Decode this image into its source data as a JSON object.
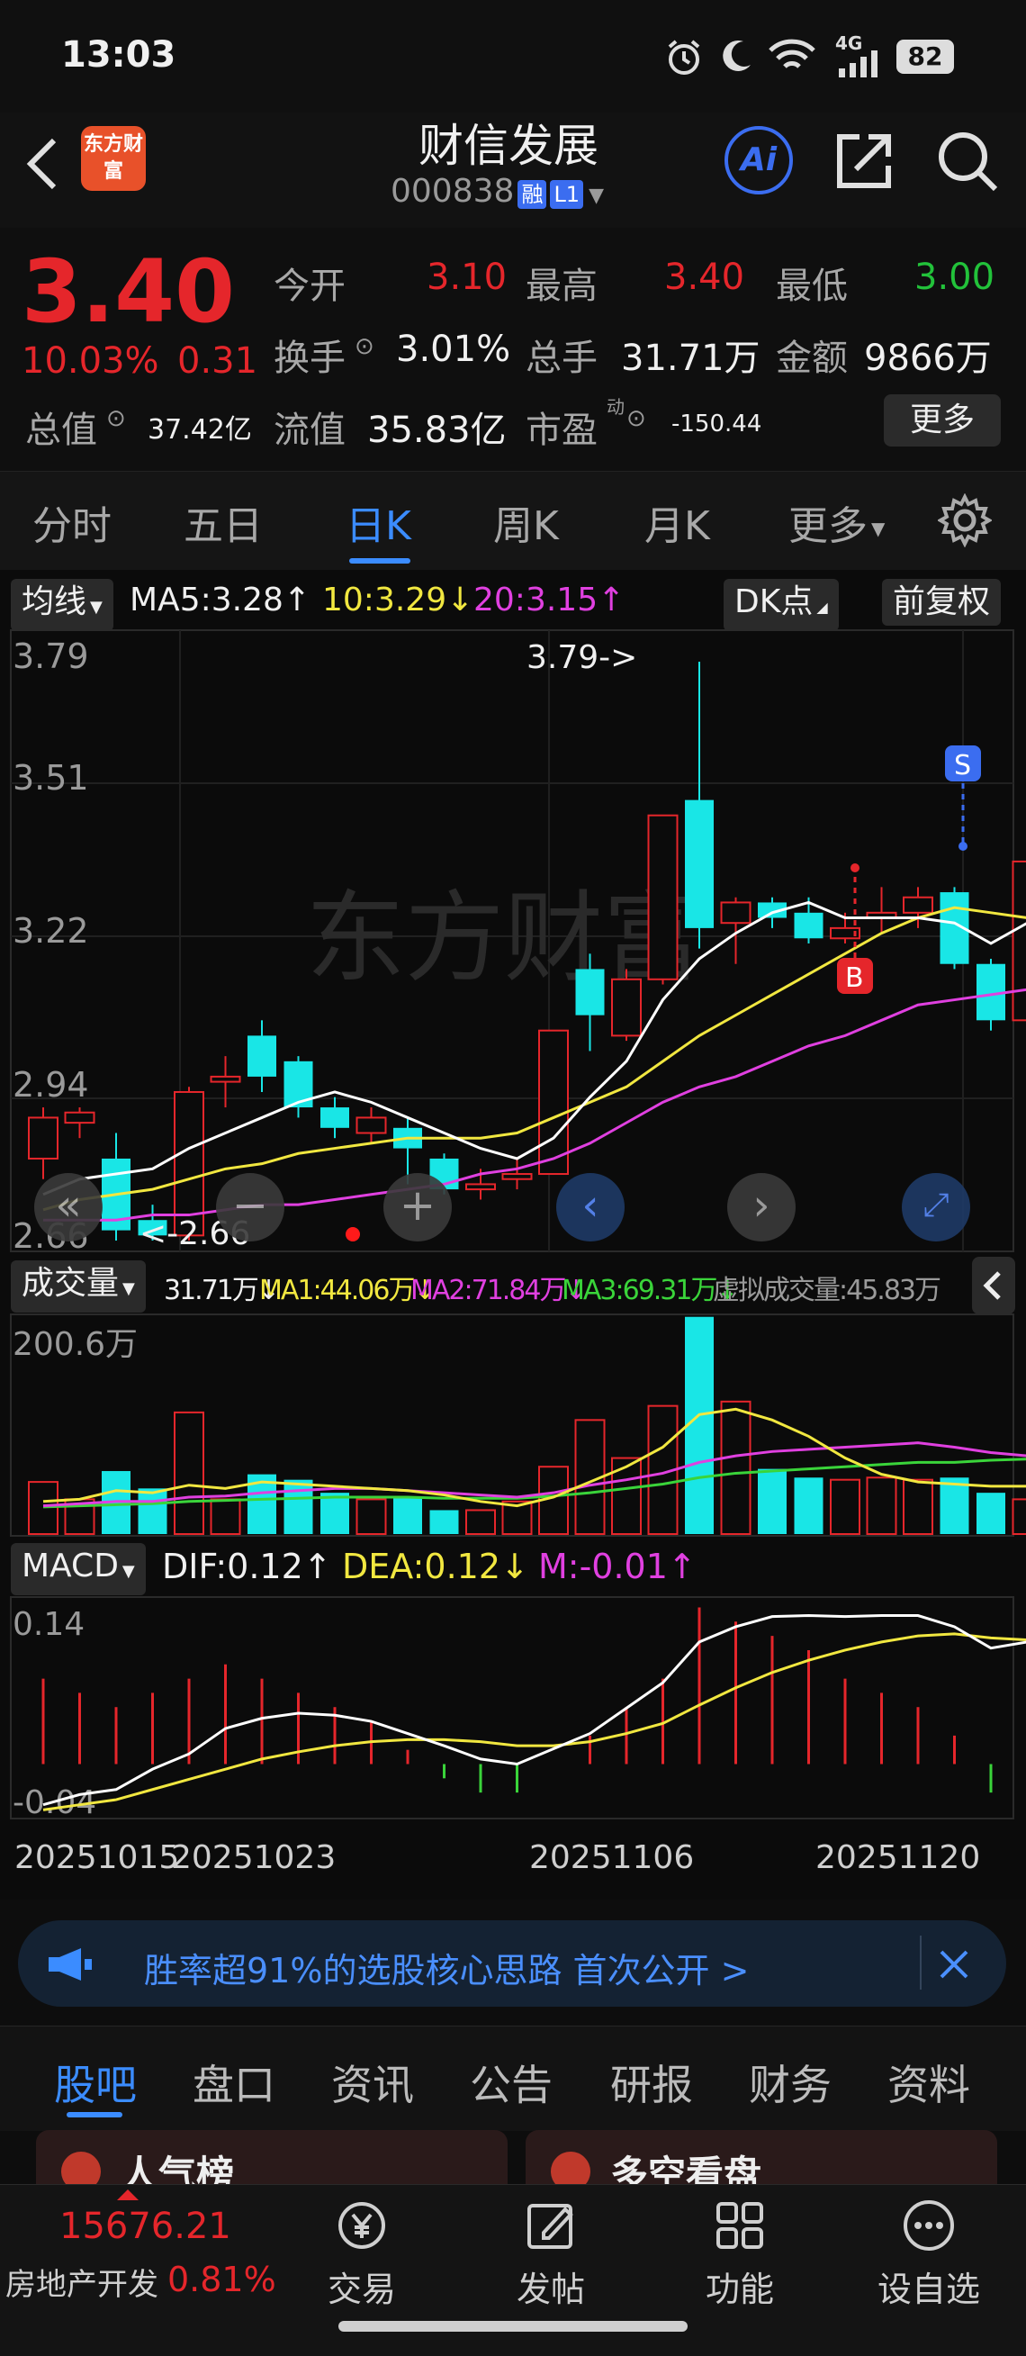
{
  "status_bar": {
    "time": "13:03",
    "signal": "4G",
    "battery": "82"
  },
  "header": {
    "logo": "东方财富",
    "title": "财信发展",
    "code": "000838",
    "tags": [
      "融",
      "L1"
    ],
    "ai_label": "Ai"
  },
  "quote": {
    "price": "3.40",
    "change_pct": "10.03%",
    "change_abs": "0.31",
    "open_label": "今开",
    "open": "3.10",
    "high_label": "最高",
    "high": "3.40",
    "low_label": "最低",
    "low": "3.00",
    "turnover_label": "换手",
    "turnover": "3.01%",
    "volume_label": "总手",
    "volume": "31.71万",
    "amount_label": "金额",
    "amount": "9866万",
    "mktcap_label": "总值",
    "mktcap": "37.42亿",
    "float_label": "流值",
    "float_cap": "35.83亿",
    "pe_label": "市盈",
    "pe_sup": "动",
    "pe": "-150.44",
    "more_label": "更多"
  },
  "period_tabs": [
    "分时",
    "五日",
    "日K",
    "周K",
    "月K",
    "更多"
  ],
  "active_period": "日K",
  "ma_bar": {
    "selector": "均线",
    "ma5": "MA5:3.28↑",
    "ma10": "10:3.29↓",
    "ma20": "20:3.15↑",
    "dk": "DK点",
    "adjust": "前复权"
  },
  "vol_bar": {
    "selector": "成交量",
    "vol": "31.71万↓",
    "ma1": "MA1:44.06万↓",
    "ma2": "MA2:71.84万↓",
    "ma3": "MA3:69.31万↓",
    "virtual": "虚拟成交量:45.83万"
  },
  "macd_bar": {
    "selector": "MACD",
    "dif": "DIF:0.12↑",
    "dea": "DEA:0.12↓",
    "m": "M:-0.01↑"
  },
  "price_axis": [
    "3.79",
    "3.51",
    "3.22",
    "2.94",
    "2.66"
  ],
  "vol_axis": [
    "200.6万"
  ],
  "macd_axis": [
    "0.14",
    "-0.04"
  ],
  "annotations": {
    "high": "3.79->",
    "low": "<-2.66",
    "buy": "B",
    "sell": "S"
  },
  "date_labels": [
    "20251015",
    "20251023",
    "20251106",
    "20251120"
  ],
  "watermark": "东方财富",
  "colors": {
    "up": "#e5262b",
    "down": "#19e6e6",
    "ma5": "#ffffff",
    "ma10": "#f1e740",
    "ma20": "#e040e0",
    "ma3": "#3ad43a",
    "accent": "#3b8cff"
  },
  "candles": [
    {
      "o": 2.82,
      "c": 2.9,
      "h": 2.92,
      "l": 2.78
    },
    {
      "o": 2.89,
      "c": 2.91,
      "h": 2.92,
      "l": 2.86
    },
    {
      "o": 2.82,
      "c": 2.68,
      "h": 2.87,
      "l": 2.66
    },
    {
      "o": 2.7,
      "c": 2.67,
      "h": 2.73,
      "l": 2.66
    },
    {
      "o": 2.67,
      "c": 2.95,
      "h": 2.96,
      "l": 2.66
    },
    {
      "o": 2.97,
      "c": 2.98,
      "h": 3.02,
      "l": 2.92
    },
    {
      "o": 3.06,
      "c": 2.98,
      "h": 3.09,
      "l": 2.95
    },
    {
      "o": 3.01,
      "c": 2.92,
      "h": 3.02,
      "l": 2.9
    },
    {
      "o": 2.92,
      "c": 2.88,
      "h": 2.94,
      "l": 2.86
    },
    {
      "o": 2.87,
      "c": 2.9,
      "h": 2.92,
      "l": 2.85
    },
    {
      "o": 2.88,
      "c": 2.84,
      "h": 2.9,
      "l": 2.77
    },
    {
      "o": 2.82,
      "c": 2.76,
      "h": 2.83,
      "l": 2.75
    },
    {
      "o": 2.76,
      "c": 2.77,
      "h": 2.8,
      "l": 2.74
    },
    {
      "o": 2.78,
      "c": 2.79,
      "h": 2.82,
      "l": 2.76
    },
    {
      "o": 2.79,
      "c": 3.07,
      "h": 3.07,
      "l": 2.79
    },
    {
      "o": 3.19,
      "c": 3.1,
      "h": 3.22,
      "l": 3.03
    },
    {
      "o": 3.06,
      "c": 3.17,
      "h": 3.19,
      "l": 3.05
    },
    {
      "o": 3.17,
      "c": 3.49,
      "h": 3.49,
      "l": 3.16
    },
    {
      "o": 3.52,
      "c": 3.27,
      "h": 3.79,
      "l": 3.23
    },
    {
      "o": 3.28,
      "c": 3.32,
      "h": 3.33,
      "l": 3.2
    },
    {
      "o": 3.32,
      "c": 3.29,
      "h": 3.33,
      "l": 3.27
    },
    {
      "o": 3.3,
      "c": 3.25,
      "h": 3.33,
      "l": 3.24
    },
    {
      "o": 3.25,
      "c": 3.27,
      "h": 3.3,
      "l": 3.24
    },
    {
      "o": 3.29,
      "c": 3.3,
      "h": 3.35,
      "l": 3.26
    },
    {
      "o": 3.3,
      "c": 3.33,
      "h": 3.35,
      "l": 3.27
    },
    {
      "o": 3.34,
      "c": 3.2,
      "h": 3.35,
      "l": 3.19
    },
    {
      "o": 3.2,
      "c": 3.09,
      "h": 3.21,
      "l": 3.07
    },
    {
      "o": 3.09,
      "c": 3.4,
      "h": 3.4,
      "l": 3.0
    }
  ],
  "ma5_line": [
    2.75,
    2.78,
    2.79,
    2.8,
    2.84,
    2.87,
    2.9,
    2.93,
    2.95,
    2.93,
    2.9,
    2.87,
    2.84,
    2.82,
    2.86,
    2.94,
    3.01,
    3.13,
    3.21,
    3.26,
    3.3,
    3.32,
    3.29,
    3.29,
    3.29,
    3.28,
    3.24,
    3.28
  ],
  "ma10_line": [
    2.72,
    2.74,
    2.75,
    2.76,
    2.78,
    2.8,
    2.81,
    2.83,
    2.84,
    2.85,
    2.86,
    2.86,
    2.86,
    2.87,
    2.9,
    2.93,
    2.96,
    3.01,
    3.06,
    3.1,
    3.14,
    3.18,
    3.22,
    3.26,
    3.29,
    3.31,
    3.3,
    3.29
  ],
  "ma20_line": [
    2.7,
    2.7,
    2.7,
    2.71,
    2.71,
    2.72,
    2.73,
    2.73,
    2.74,
    2.75,
    2.76,
    2.77,
    2.79,
    2.8,
    2.82,
    2.85,
    2.89,
    2.93,
    2.96,
    2.98,
    3.01,
    3.04,
    3.06,
    3.09,
    3.12,
    3.13,
    3.14,
    3.15
  ],
  "volumes": [
    [
      48,
      1
    ],
    [
      32,
      1
    ],
    [
      58,
      0
    ],
    [
      42,
      0
    ],
    [
      112,
      1
    ],
    [
      32,
      1
    ],
    [
      55,
      0
    ],
    [
      50,
      0
    ],
    [
      38,
      0
    ],
    [
      32,
      1
    ],
    [
      34,
      0
    ],
    [
      22,
      0
    ],
    [
      22,
      1
    ],
    [
      30,
      1
    ],
    [
      62,
      1
    ],
    [
      105,
      1
    ],
    [
      70,
      1
    ],
    [
      118,
      1
    ],
    [
      200,
      0
    ],
    [
      122,
      1
    ],
    [
      60,
      0
    ],
    [
      52,
      0
    ],
    [
      50,
      1
    ],
    [
      52,
      1
    ],
    [
      50,
      1
    ],
    [
      52,
      0
    ],
    [
      38,
      0
    ],
    [
      32,
      1
    ]
  ],
  "vol_ma1": [
    30,
    32,
    40,
    38,
    45,
    42,
    48,
    46,
    44,
    42,
    40,
    36,
    30,
    26,
    34,
    48,
    62,
    80,
    110,
    115,
    105,
    90,
    70,
    55,
    48,
    46,
    44,
    44
  ],
  "vol_ma2": [
    26,
    28,
    30,
    30,
    34,
    35,
    38,
    40,
    42,
    42,
    40,
    38,
    36,
    34,
    38,
    45,
    50,
    56,
    66,
    72,
    76,
    78,
    80,
    82,
    84,
    80,
    75,
    72
  ],
  "vol_ma3": [
    25,
    26,
    27,
    28,
    30,
    31,
    32,
    33,
    34,
    34,
    34,
    33,
    33,
    33,
    35,
    38,
    42,
    46,
    52,
    56,
    58,
    60,
    62,
    64,
    66,
    66,
    68,
    69
  ],
  "macd_dif": [
    -0.04,
    -0.03,
    -0.025,
    -0.005,
    0.01,
    0.035,
    0.045,
    0.05,
    0.048,
    0.042,
    0.03,
    0.018,
    0.005,
    0.0,
    0.015,
    0.03,
    0.055,
    0.08,
    0.12,
    0.135,
    0.145,
    0.146,
    0.145,
    0.146,
    0.146,
    0.135,
    0.114,
    0.12
  ],
  "macd_dea": [
    -0.045,
    -0.04,
    -0.035,
    -0.025,
    -0.015,
    -0.005,
    0.005,
    0.012,
    0.018,
    0.022,
    0.024,
    0.024,
    0.022,
    0.018,
    0.018,
    0.022,
    0.03,
    0.04,
    0.058,
    0.075,
    0.09,
    0.102,
    0.112,
    0.12,
    0.126,
    0.128,
    0.124,
    0.122
  ],
  "macd_m": [
    0.06,
    0.05,
    0.04,
    0.05,
    0.06,
    0.07,
    0.06,
    0.05,
    0.04,
    0.03,
    0.01,
    -0.01,
    -0.02,
    -0.02,
    0.0,
    0.02,
    0.04,
    0.06,
    0.11,
    0.1,
    0.09,
    0.08,
    0.06,
    0.05,
    0.04,
    0.02,
    -0.02,
    -0.01
  ],
  "banner": {
    "text": "胜率超91%的选股核心思路 首次公开 >"
  },
  "info_tabs": [
    "股吧",
    "盘口",
    "资讯",
    "公告",
    "研报",
    "财务",
    "资料"
  ],
  "active_info_tab": "股吧",
  "cards": [
    "人气榜",
    "多空看盘"
  ],
  "bottom_nav": {
    "index_value": "15676.21",
    "index_name": "房地产开发",
    "index_change": "0.81%",
    "items": [
      "交易",
      "发帖",
      "功能",
      "设自选"
    ]
  }
}
